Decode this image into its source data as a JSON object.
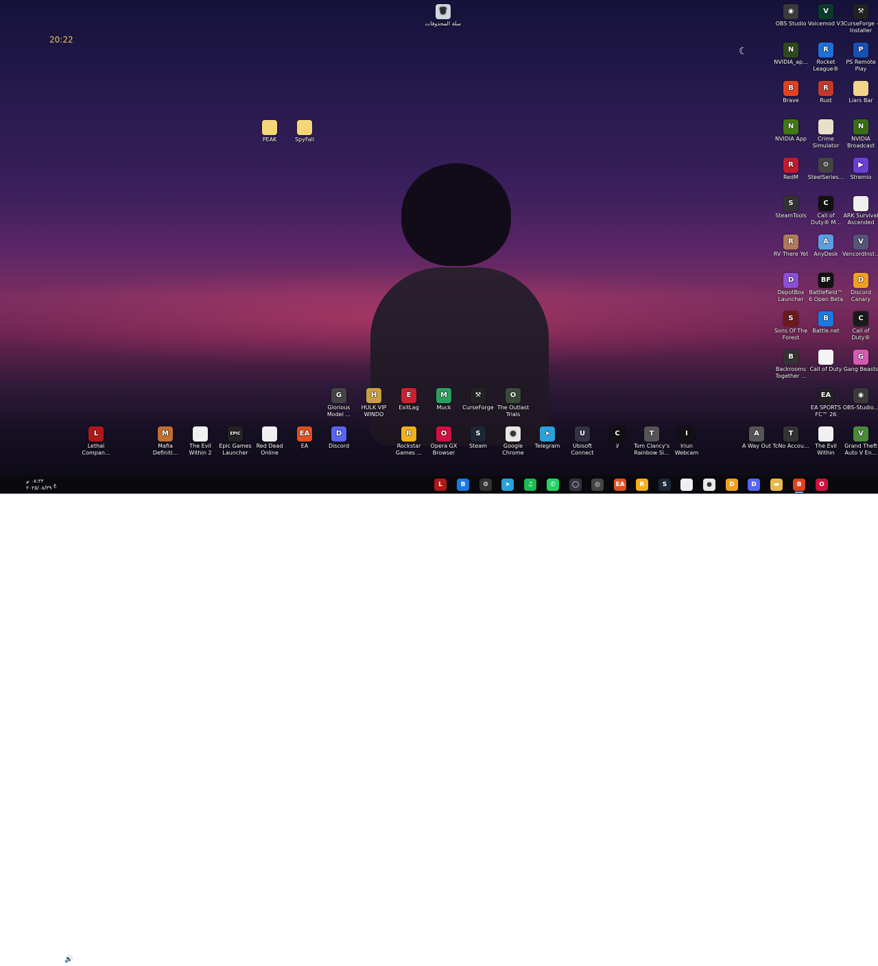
{
  "clock_widget": "20:22",
  "recycle_bin": {
    "label": "سلة المحذوفات"
  },
  "folders": [
    {
      "label": "PEAK"
    },
    {
      "label": "SpyFall"
    }
  ],
  "right_icons": [
    {
      "label": "OBS Studio",
      "color": "#3a3a3a",
      "glyph": "◉"
    },
    {
      "label": "Voicemod V3",
      "color": "#0b3b2b",
      "glyph": "V"
    },
    {
      "label": "CurseForge - Installer",
      "color": "#222222",
      "glyph": "⚒"
    },
    {
      "label": "NVIDIA_ap...",
      "color": "#2e4a1a",
      "glyph": "N"
    },
    {
      "label": "Rocket League®",
      "color": "#1e6fd6",
      "glyph": "R"
    },
    {
      "label": "PS Remote Play",
      "color": "#1a4fb5",
      "glyph": "P"
    },
    {
      "label": "Brave",
      "color": "#e0421e",
      "glyph": "B"
    },
    {
      "label": "Rust",
      "color": "#c0392b",
      "glyph": "R"
    },
    {
      "label": "Liars Bar",
      "color": "#f2d48a",
      "glyph": ""
    },
    {
      "label": "NVIDIA App",
      "color": "#3f7a12",
      "glyph": "N"
    },
    {
      "label": "Crime Simulator",
      "color": "#e8e0c8",
      "glyph": ""
    },
    {
      "label": "NVIDIA Broadcast",
      "color": "#3a6e16",
      "glyph": "N"
    },
    {
      "label": "RedM",
      "color": "#c21c2c",
      "glyph": "R"
    },
    {
      "label": "SteelSeries...",
      "color": "#444444",
      "glyph": "⚙"
    },
    {
      "label": "Stremio",
      "color": "#6b3fd6",
      "glyph": "▶"
    },
    {
      "label": "SteamTools",
      "color": "#333333",
      "glyph": "S"
    },
    {
      "label": "Call of Duty® M...",
      "color": "#111111",
      "glyph": "C"
    },
    {
      "label": "ARK Survival Ascended",
      "color": "#f0f0f0",
      "glyph": ""
    },
    {
      "label": "RV There Yet",
      "color": "#b07a5a",
      "glyph": "R"
    },
    {
      "label": "AnyDesk",
      "color": "#5aa0e0",
      "glyph": "A"
    },
    {
      "label": "VencordInst...",
      "color": "#555577",
      "glyph": "V"
    },
    {
      "label": "DepotBox Launcher",
      "color": "#8a4fd6",
      "glyph": "D"
    },
    {
      "label": "Battlefield™ 6 Open Beta",
      "color": "#111111",
      "glyph": "BF"
    },
    {
      "label": "Discord Canary",
      "color": "#f0a020",
      "glyph": "D"
    },
    {
      "label": "Sons Of The Forest",
      "color": "#6a1a1a",
      "glyph": "S"
    },
    {
      "label": "Battle.net",
      "color": "#1a7ae0",
      "glyph": "B"
    },
    {
      "label": "Call of Duty®",
      "color": "#1a1a1a",
      "glyph": "C"
    },
    {
      "label": "Backrooms Together ...",
      "color": "#333333",
      "glyph": "B"
    },
    {
      "label": "Call of Duty",
      "color": "#f4f4f4",
      "glyph": ""
    },
    {
      "label": "Gang Beasts",
      "color": "#d65ab0",
      "glyph": "G"
    },
    {
      "label": "",
      "color": "",
      "glyph": ""
    },
    {
      "label": "EA SPORTS FC™ 26",
      "color": "#222222",
      "glyph": "EA"
    },
    {
      "label": "OBS-Studio...",
      "color": "#3a3a3a",
      "glyph": "◉"
    }
  ],
  "row1_icons": [
    {
      "label": "Glorious Model ...",
      "color": "#444444",
      "glyph": "G"
    },
    {
      "label": "HULK VIP WINDO",
      "color": "#c8a040",
      "glyph": "H"
    },
    {
      "label": "ExitLag",
      "color": "#d02030",
      "glyph": "E"
    },
    {
      "label": "Muck",
      "color": "#2aa060",
      "glyph": "M"
    },
    {
      "label": "CurseForge",
      "color": "#222222",
      "glyph": "⚒"
    },
    {
      "label": "The Outlast Trials",
      "color": "#3a4a3a",
      "glyph": "O"
    }
  ],
  "row2_icons": [
    {
      "label": "Lethal Compan...",
      "color": "#b01818",
      "glyph": "L"
    },
    {
      "label": "Mafia Definiti...",
      "color": "#c07030",
      "glyph": "M"
    },
    {
      "label": "The Evil Within 2",
      "color": "#f0f0f0",
      "glyph": ""
    },
    {
      "label": "Epic Games Launcher",
      "color": "#222222",
      "glyph": "EPIC"
    },
    {
      "label": "Red Dead Online",
      "color": "#f0f0f0",
      "glyph": ""
    },
    {
      "label": "EA",
      "color": "#e05020",
      "glyph": "EA"
    },
    {
      "label": "Discord",
      "color": "#5865f2",
      "glyph": "D"
    },
    {
      "label": "Rockstar Games ...",
      "color": "#f2b01e",
      "glyph": "R"
    },
    {
      "label": "Opera GX Browser",
      "color": "#d01040",
      "glyph": "O"
    },
    {
      "label": "Steam",
      "color": "#1b2838",
      "glyph": "S"
    },
    {
      "label": "Google Chrome",
      "color": "#e8e8e8",
      "glyph": "●"
    },
    {
      "label": "Telegram",
      "color": "#2aa1da",
      "glyph": "➤"
    },
    {
      "label": "Ubisoft Connect",
      "color": "#333344",
      "glyph": "U"
    },
    {
      "label": "لا",
      "color": "#111111",
      "glyph": "C"
    },
    {
      "label": "Tom Clancy's Rainbow Si...",
      "color": "#555555",
      "glyph": "T"
    },
    {
      "label": "Iriun Webcam",
      "color": "#111111",
      "glyph": "I"
    },
    {
      "label": "A Way Out",
      "color": "#555555",
      "glyph": "A"
    },
    {
      "label": "TcNo Accou...",
      "color": "#333333",
      "glyph": "T"
    },
    {
      "label": "The Evil Within",
      "color": "#f0f0f0",
      "glyph": ""
    },
    {
      "label": "Grand Theft Auto V En...",
      "color": "#4a8a3a",
      "glyph": "V"
    }
  ],
  "taskbar": {
    "apps": [
      {
        "name": "app-1",
        "color": "#b01818",
        "glyph": "L"
      },
      {
        "name": "app-2",
        "color": "#1a7ae0",
        "glyph": "B"
      },
      {
        "name": "app-3",
        "color": "#333333",
        "glyph": "⚙"
      },
      {
        "name": "app-4",
        "color": "#2aa1da",
        "glyph": "➤"
      },
      {
        "name": "app-5",
        "color": "#1db954",
        "glyph": "♫"
      },
      {
        "name": "app-6",
        "color": "#25d366",
        "glyph": "✆"
      },
      {
        "name": "app-7",
        "color": "#333344",
        "glyph": "◯"
      },
      {
        "name": "app-8",
        "color": "#444444",
        "glyph": "◎"
      },
      {
        "name": "app-9",
        "color": "#e05020",
        "glyph": "EA"
      },
      {
        "name": "app-10",
        "color": "#f2b01e",
        "glyph": "R"
      },
      {
        "name": "app-11",
        "color": "#1b2838",
        "glyph": "S"
      },
      {
        "name": "app-12",
        "color": "#f0f0f0",
        "glyph": ""
      },
      {
        "name": "app-13",
        "color": "#e8e8e8",
        "glyph": "●"
      },
      {
        "name": "app-14",
        "color": "#f0a020",
        "glyph": "D"
      },
      {
        "name": "app-15",
        "color": "#5865f2",
        "glyph": "D"
      },
      {
        "name": "app-16",
        "color": "#e8b84a",
        "glyph": "▬"
      },
      {
        "name": "app-17",
        "color": "#e0421e",
        "glyph": "B"
      },
      {
        "name": "app-18",
        "color": "#d01040",
        "glyph": "O"
      }
    ],
    "search_icon": "⌕",
    "windows_icon": "⊞",
    "time": "٠٨:٢٢ م",
    "date": "٢٠٢٥/٠٨/٢٩",
    "lang": "ع"
  }
}
